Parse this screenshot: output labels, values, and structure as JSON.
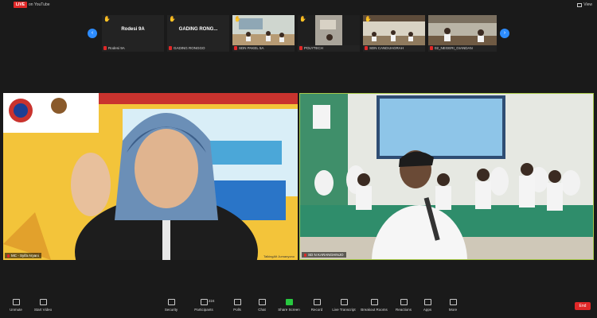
{
  "topbar": {
    "live_badge": "LIVE",
    "live_label": "on YouTube",
    "view_label": "View"
  },
  "strip": {
    "prev_icon": "chevron-left-icon",
    "next_icon": "chevron-right-icon",
    "tiles": [
      {
        "big": "Rodesi 9A",
        "caption": "Rodesi 9A",
        "hand": true
      },
      {
        "big": "GADING RONG...",
        "caption": "GADING RONGGO",
        "hand": true
      },
      {
        "big": "",
        "caption": "SDN PAKEL 5A",
        "hand": true
      },
      {
        "big": "",
        "caption": "POLYTECH",
        "hand": true
      },
      {
        "big": "",
        "caption": "SDN CANDIJAGRAH",
        "hand": true
      },
      {
        "big": "",
        "caption": "02_NEGERI_GIANDAN",
        "hand": false
      }
    ]
  },
  "main": {
    "left_logo_text": "PUSKURLURULAHRA NASIONAL",
    "left_banner_text": "NGRA",
    "left_banner_sub": "virtual tour",
    "left_name": "MC - Syifa Aryani",
    "left_watermark": "TalkingAlt Jumanyono",
    "right_name": "SD N KARANGHINJO"
  },
  "toolbar": {
    "items": [
      {
        "label": "Unmute",
        "icon": "microphone-icon"
      },
      {
        "label": "Start Video",
        "icon": "video-camera-icon"
      },
      {
        "label": "Security",
        "icon": "shield-icon"
      },
      {
        "label": "Participants",
        "icon": "participants-icon",
        "count": "224"
      },
      {
        "label": "Polls",
        "icon": "polls-icon"
      },
      {
        "label": "Chat",
        "icon": "chat-icon"
      },
      {
        "label": "Share Screen",
        "icon": "share-screen-icon"
      },
      {
        "label": "Record",
        "icon": "record-icon"
      },
      {
        "label": "Live Transcript",
        "icon": "cc-icon"
      },
      {
        "label": "Breakout Rooms",
        "icon": "breakout-rooms-icon"
      },
      {
        "label": "Reactions",
        "icon": "reactions-icon"
      },
      {
        "label": "Apps",
        "icon": "apps-icon"
      },
      {
        "label": "More",
        "icon": "more-icon"
      }
    ],
    "end_label": "End"
  },
  "colors": {
    "accent": "#2d8cff",
    "danger": "#e02828",
    "share": "#28c840"
  }
}
